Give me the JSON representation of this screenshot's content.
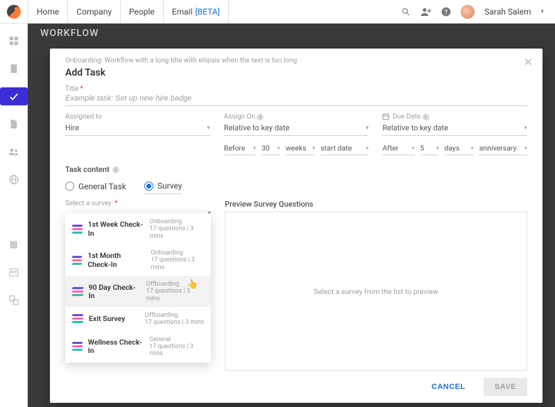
{
  "topnav": {
    "tabs": [
      "Home",
      "Company",
      "People"
    ],
    "beta_tab": {
      "label": "Email",
      "badge": "[BETA]"
    },
    "user_name": "Sarah Salem"
  },
  "page": {
    "title": "WORKFLOW"
  },
  "modal": {
    "breadcrumb": "Onboarding: Workflow with a long title with ellipsis when the text is too long",
    "title": "Add Task",
    "title_field": {
      "label": "Title",
      "placeholder": "Example task: Set up new hire badge"
    },
    "assigned_to": {
      "label": "Assigned to",
      "value": "Hire"
    },
    "assign_on": {
      "label": "Assign On",
      "value": "Relative to key date",
      "rel": {
        "dir": "Before",
        "num": "30",
        "unit": "weeks",
        "key": "start date"
      }
    },
    "due_date": {
      "label": "Due Date",
      "value": "Relative to key date",
      "rel": {
        "dir": "After",
        "num": "5",
        "unit": "days",
        "key": "anniversary"
      }
    },
    "task_content": {
      "label": "Task content",
      "options": [
        "General Task",
        "Survey"
      ],
      "selected": "Survey"
    },
    "survey_select": {
      "label": "Select a survey"
    },
    "surveys": [
      {
        "name": "1st Week Check-In",
        "cat": "Onboarding",
        "meta": "17 questions | 3 mins"
      },
      {
        "name": "1st Month Check-In",
        "cat": "Onboarding",
        "meta": "17 questions | 3 mins"
      },
      {
        "name": "90 Day Check-In",
        "cat": "Offboarding",
        "meta": "17 questions | 3 mins"
      },
      {
        "name": "Exit Survey",
        "cat": "Offboarding",
        "meta": "17 questions | 3 mins"
      },
      {
        "name": "Wellness Check-In",
        "cat": "General",
        "meta": "17 questions | 3 mins"
      }
    ],
    "preview": {
      "label": "Preview Survey Questions",
      "empty": "Select a survey from the list to preview"
    },
    "buttons": {
      "cancel": "CANCEL",
      "save": "SAVE"
    }
  }
}
